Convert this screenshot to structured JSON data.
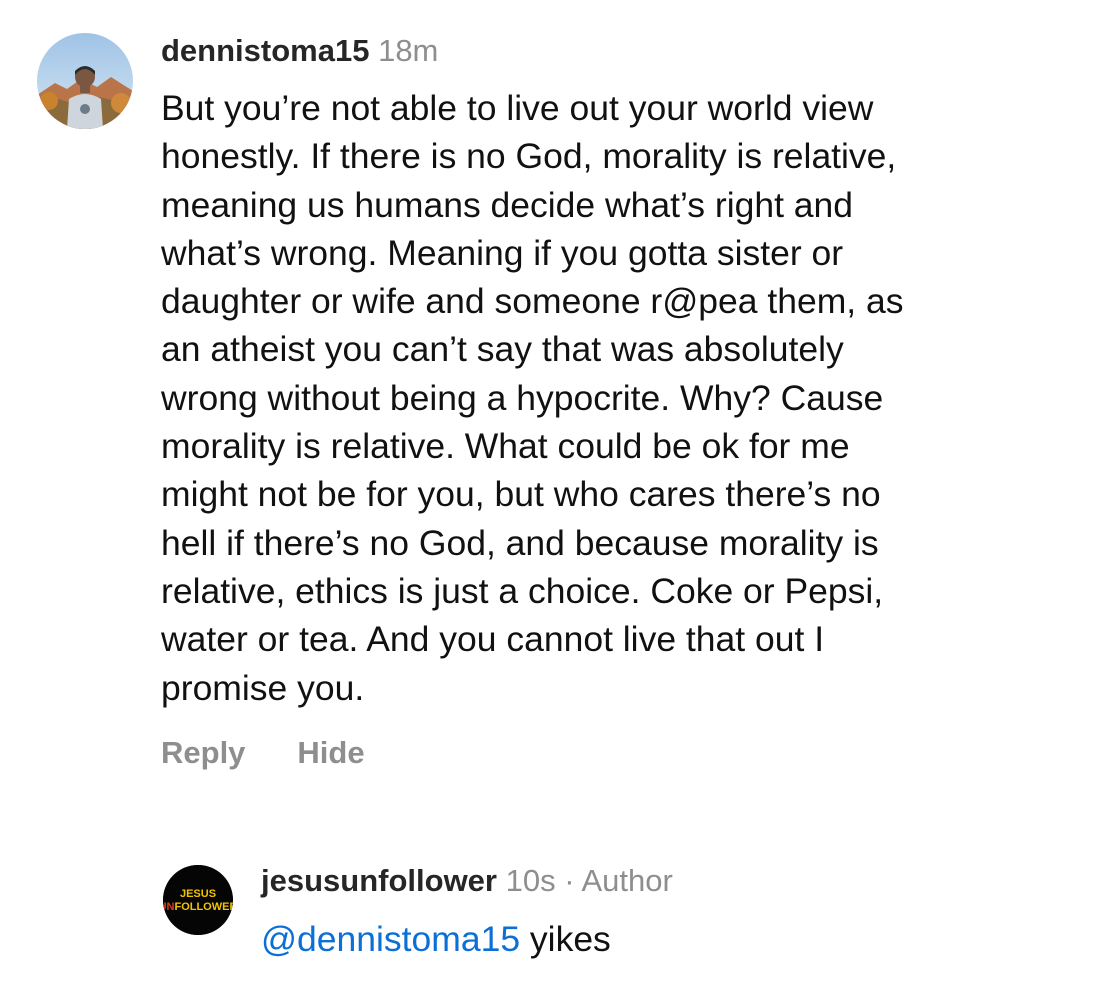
{
  "comment": {
    "username": "dennistoma15",
    "time": "18m",
    "text": "But you’re not able to live out your world view\nhonestly. If there is no God, morality is relative,\nmeaning us humans decide what’s right and\nwhat’s wrong. Meaning if you gotta sister or\ndaughter or wife and someone r@pea them, as\nan atheist you can’t say that was absolutely\nwrong without being a hypocrite. Why? Cause\nmorality is relative. What could be ok for me\nmight not be for you, but who cares there’s no\nhell if there’s no God, and because morality is\nrelative, ethics is just a choice. Coke or Pepsi,\nwater or tea. And you cannot live that out I\npromise you.",
    "actions": {
      "reply": "Reply",
      "hide": "Hide"
    },
    "avatar_icon": "profile-photo-icon"
  },
  "reply": {
    "username": "jesusunfollower",
    "time": "10s",
    "separator": "·",
    "role": "Author",
    "mention": "@dennistoma15",
    "text": " yikes",
    "avatar_logo_line1": "JESUS",
    "avatar_logo_line2_a": "UN",
    "avatar_logo_line2_b": "FOLLOWER"
  },
  "colors": {
    "mention": "#0b6fd6",
    "meta": "#8e8e8e",
    "logo_yellow": "#f2c200",
    "logo_red": "#e03a1e"
  }
}
